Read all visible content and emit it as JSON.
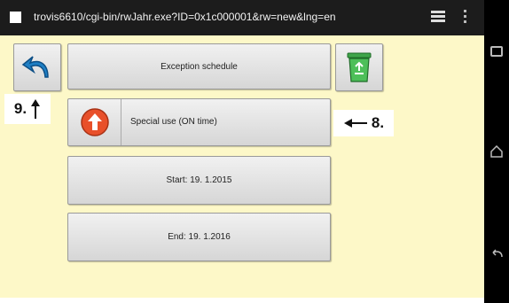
{
  "browser": {
    "url": "trovis6610/cgi-bin/rwJahr.exe?ID=0x1c000001&rw=new&lng=en",
    "icons": [
      "tab-square-icon",
      "menu-stack-icon",
      "overflow-dots-icon"
    ]
  },
  "page": {
    "header_label": "Exception schedule",
    "special_use_label": "Special use (ON time)",
    "start_label": "Start: 19. 1.2015",
    "end_label": "End: 19. 1.2016",
    "icons": [
      "back-arrow-icon",
      "recycle-bin-icon",
      "up-arrow-icon"
    ]
  },
  "annotations": {
    "callout_9": "9.",
    "callout_8": "8."
  },
  "system_nav": {
    "icons": [
      "recents-icon",
      "home-icon",
      "back-icon"
    ]
  },
  "colors": {
    "page_background": "#fdf8c8",
    "address_bar": "#1c1c1c",
    "up_button": "#e8502a"
  }
}
